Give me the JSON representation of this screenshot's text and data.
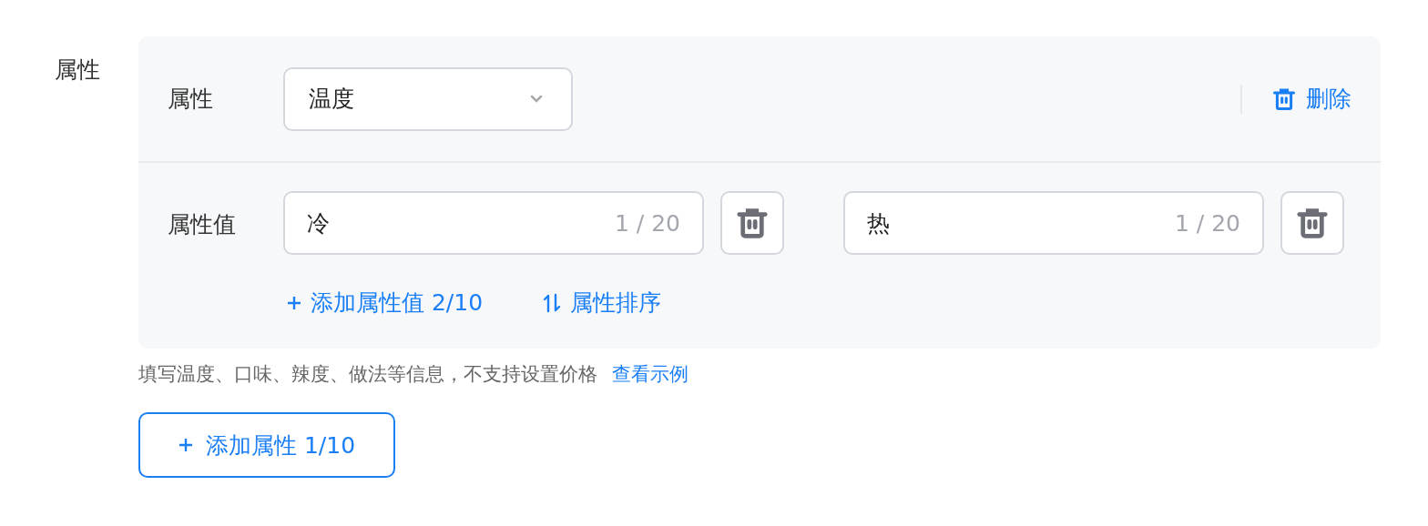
{
  "field_label": "属性",
  "attribute": {
    "label": "属性",
    "select_value": "温度",
    "delete": "删除",
    "values_label": "属性值",
    "values": [
      {
        "value": "冷",
        "counter": "1 / 20"
      },
      {
        "value": "热",
        "counter": "1 / 20"
      }
    ],
    "add_value": "添加属性值 2/10",
    "sort": "属性排序"
  },
  "hint": "填写温度、口味、辣度、做法等信息，不支持设置价格",
  "example_link": "查看示例",
  "add_attribute": "添加属性 1/10"
}
